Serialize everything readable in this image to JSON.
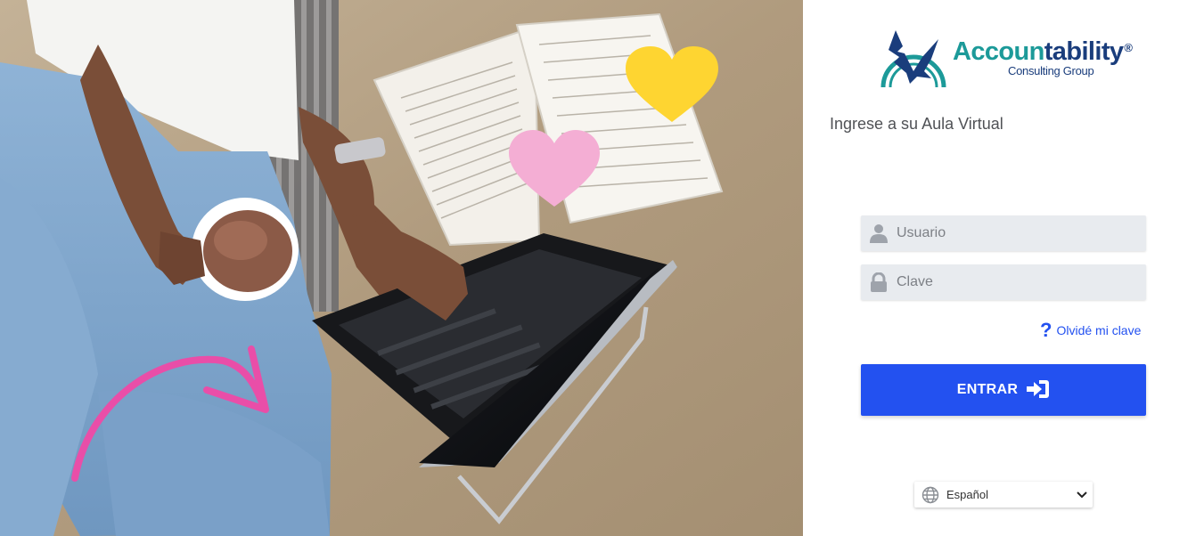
{
  "colors": {
    "accent": "#2351f0",
    "brand_navy": "#1a3d7c",
    "brand_teal": "#1c9a99",
    "field_bg": "#e8ebef",
    "heart_yellow": "#fed531",
    "heart_pink": "#f4aed4",
    "arrow_pink": "#e94ea8"
  },
  "brand": {
    "word_teal": "Accoun",
    "word_rest": "tability",
    "registered": "®",
    "subtitle": "Consulting Group"
  },
  "heading": "Ingrese a su Aula Virtual",
  "form": {
    "user": {
      "placeholder": "Usuario",
      "value": "",
      "icon": "user-icon"
    },
    "password": {
      "placeholder": "Clave",
      "value": "",
      "icon": "lock-icon"
    }
  },
  "forgot": {
    "icon": "question-icon",
    "label": "Olvidé mi clave"
  },
  "submit": {
    "label": "ENTRAR",
    "icon": "sign-in-icon"
  },
  "language": {
    "selected": "Español",
    "icon": "globe-icon"
  }
}
